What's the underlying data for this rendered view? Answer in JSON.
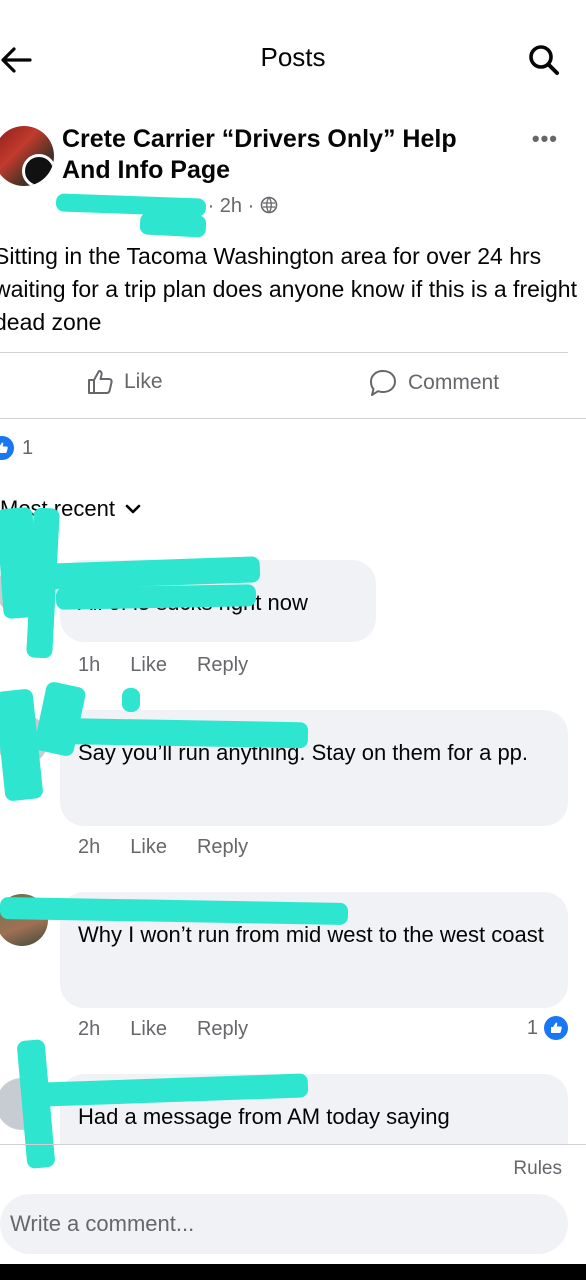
{
  "header": {
    "title": "Posts"
  },
  "post": {
    "group_name": "Crete Carrier “Drivers Only” Help And Info Page",
    "time": "· 2h ·",
    "text": "Sitting in the Tacoma Washington area for over 24 hrs waiting for a trip plan does anyone know if this is a freight dead zone",
    "like_label": "Like",
    "comment_label": "Comment",
    "reaction_count": "1"
  },
  "sort": {
    "label": "Most recent"
  },
  "comments": [
    {
      "text": "All of i5 sucks right now",
      "time": "1h",
      "like": "Like",
      "reply": "Reply"
    },
    {
      "text": "Say you’ll run anything. Stay on them for a pp.",
      "time": "2h",
      "like": "Like",
      "reply": "Reply"
    },
    {
      "text": "Why I won’t run from mid west to the west coast",
      "time": "2h",
      "like": "Like",
      "reply": "Reply",
      "reactions": "1"
    },
    {
      "text": "Had a message from AM today saying"
    }
  ],
  "footer": {
    "rules": "Rules",
    "composer_placeholder": "Write a comment..."
  },
  "colors": {
    "accent": "#1877f2",
    "scribble": "#2ee6cf",
    "bubble": "#f0f2f5"
  },
  "icons": [
    "back-arrow-icon",
    "search-icon",
    "more-icon",
    "globe-icon",
    "like-icon",
    "comment-icon",
    "chevron-down-icon"
  ]
}
